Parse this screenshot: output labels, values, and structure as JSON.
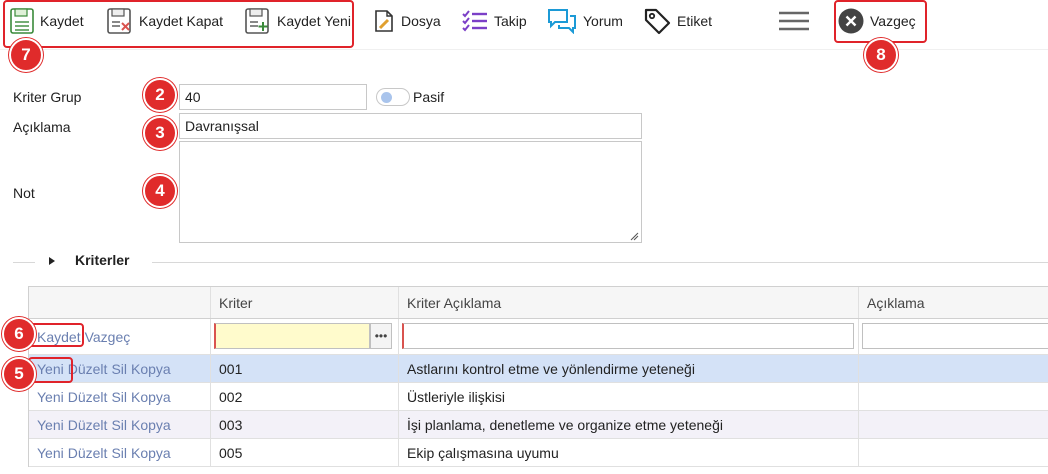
{
  "toolbar": {
    "save": "Kaydet",
    "save_close": "Kaydet Kapat",
    "save_new": "Kaydet Yeni",
    "file": "Dosya",
    "follow": "Takip",
    "comment": "Yorum",
    "tag": "Etiket",
    "cancel": "Vazgeç"
  },
  "badges": {
    "b2": "2",
    "b3": "3",
    "b4": "4",
    "b5": "5",
    "b6": "6",
    "b7": "7",
    "b8": "8"
  },
  "form": {
    "group_label": "Kriter Grup",
    "group_value": "40",
    "passive_label": "Pasif",
    "description_label": "Açıklama",
    "description_value": "Davranışsal",
    "note_label": "Not",
    "note_value": ""
  },
  "section": {
    "title": "Kriterler"
  },
  "grid": {
    "columns": [
      "",
      "Kriter",
      "Kriter Açıklama",
      "Açıklama"
    ],
    "edit_actions": {
      "save": "Kaydet",
      "cancel": "Vazgeç"
    },
    "row_actions": {
      "new": "Yeni",
      "edit": "Düzelt",
      "delete": "Sil",
      "copy": "Kopya"
    },
    "rows": [
      {
        "code": "001",
        "criteria_description": "Astlarını kontrol etme ve yönlendirme yeteneği",
        "description": ""
      },
      {
        "code": "002",
        "criteria_description": "Üstleriyle ilişkisi",
        "description": ""
      },
      {
        "code": "003",
        "criteria_description": "İşi planlama, denetleme ve organize etme yeteneği",
        "description": ""
      },
      {
        "code": "005",
        "criteria_description": "Ekip çalışmasına uyumu",
        "description": ""
      }
    ]
  },
  "colors": {
    "accent_red": "#e0232a",
    "selected_row": "#d4e2f7",
    "action_link": "#6a7fb0"
  }
}
